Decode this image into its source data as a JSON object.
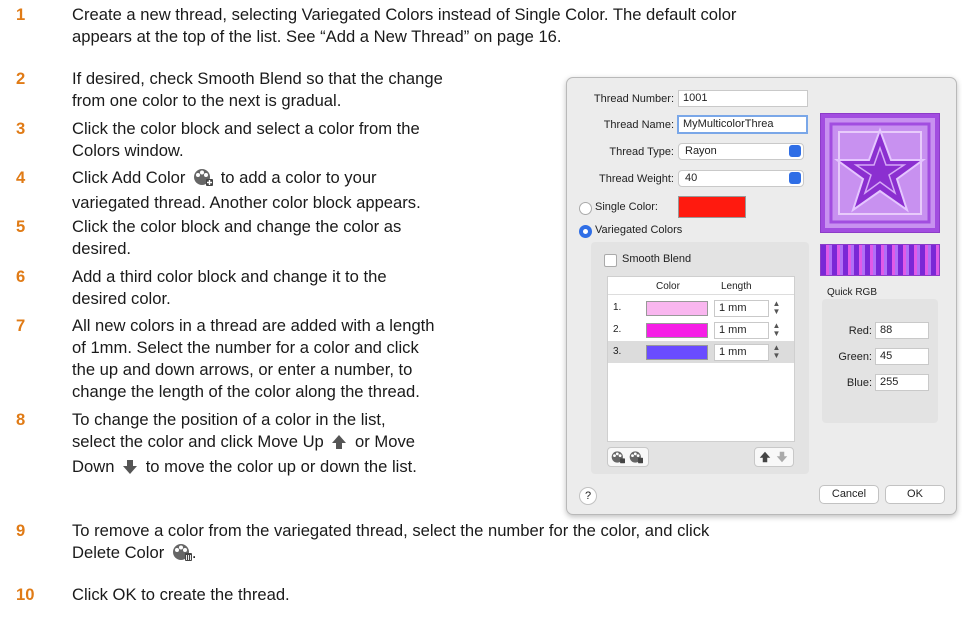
{
  "steps": [
    {
      "num": "1",
      "lines": [
        "Create a new thread, selecting Variegated Colors instead of Single Color. The default color",
        "appears at the top of the list. See “Add a New Thread” on page 16."
      ]
    },
    {
      "num": "2",
      "lines": [
        "If desired, check Smooth Blend so that the change",
        "from one color to the next is gradual."
      ]
    },
    {
      "num": "3",
      "lines": [
        "Click the color block and select a color from the",
        "Colors window."
      ]
    },
    {
      "num": "4",
      "lines": [
        "Click Add Color",
        "to add a color to your",
        "variegated thread. Another color block appears."
      ]
    },
    {
      "num": "5",
      "lines": [
        "Click the color block and change the color as",
        "desired."
      ]
    },
    {
      "num": "6",
      "lines": [
        "Add a third color block and change it to the",
        "desired color."
      ]
    },
    {
      "num": "7",
      "lines": [
        "All new colors in a thread are added with a length",
        "of 1mm. Select the number for a color and click",
        "the up and down arrows, or enter a number, to",
        "change the length of the color along the thread."
      ]
    },
    {
      "num": "8",
      "lines": [
        "To change the position of a color in the list,",
        "select the color and click Move Up",
        "or Move",
        "Down",
        "to move the color up or down the list."
      ]
    },
    {
      "num": "9",
      "lines": [
        "To remove a color from the variegated thread, select the number for the color, and click",
        "Delete Color",
        "."
      ]
    },
    {
      "num": "10",
      "lines": [
        "Click OK to create the thread."
      ]
    }
  ],
  "dialog": {
    "thread_number_label": "Thread Number:",
    "thread_number_value": "1001",
    "thread_name_label": "Thread Name:",
    "thread_name_value": "MyMulticolorThrea",
    "thread_type_label": "Thread Type:",
    "thread_type_value": "Rayon",
    "thread_weight_label": "Thread Weight:",
    "thread_weight_value": "40",
    "single_color_label": "Single Color:",
    "single_color_hex": "#ff1a0f",
    "variegated_label": "Variegated Colors",
    "smooth_blend_label": "Smooth Blend",
    "col_color": "Color",
    "col_length": "Length",
    "rows": [
      {
        "idx": "1.",
        "color": "#f9b6ef",
        "length": "1 mm"
      },
      {
        "idx": "2.",
        "color": "#f61ee6",
        "length": "1 mm"
      },
      {
        "idx": "3.",
        "color": "#6a4cff",
        "length": "1 mm"
      }
    ],
    "quick_rgb_label": "Quick RGB",
    "red_label": "Red:",
    "red_value": "88",
    "green_label": "Green:",
    "green_value": "45",
    "blue_label": "Blue:",
    "blue_value": "255",
    "help_label": "?",
    "cancel_label": "Cancel",
    "ok_label": "OK"
  },
  "colors": {
    "step_number": "#e07b16",
    "accent": "#2f6ee6",
    "preview_purple": "#a24de0"
  }
}
